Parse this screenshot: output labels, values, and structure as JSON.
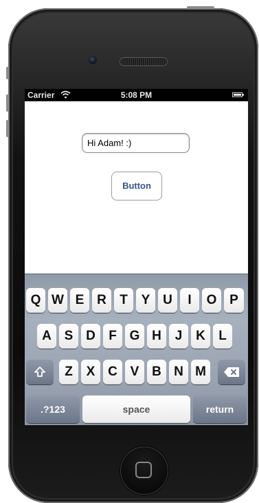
{
  "statusbar": {
    "carrier": "Carrier",
    "time": "5:08 PM"
  },
  "app": {
    "textfield_value": "Hi Adam! :)",
    "button_label": "Button"
  },
  "keyboard": {
    "row1": [
      "Q",
      "W",
      "E",
      "R",
      "T",
      "Y",
      "U",
      "I",
      "O",
      "P"
    ],
    "row2": [
      "A",
      "S",
      "D",
      "F",
      "G",
      "H",
      "J",
      "K",
      "L"
    ],
    "row3": [
      "Z",
      "X",
      "C",
      "V",
      "B",
      "N",
      "M"
    ],
    "shift_icon": "shift-arrow-icon",
    "delete_icon": "backspace-icon",
    "numbers_label": ".?123",
    "space_label": "space",
    "return_label": "return"
  },
  "hardware": {
    "camera_icon": "camera-icon",
    "speaker_icon": "speaker-grille-icon",
    "home_icon": "home-button-icon"
  }
}
